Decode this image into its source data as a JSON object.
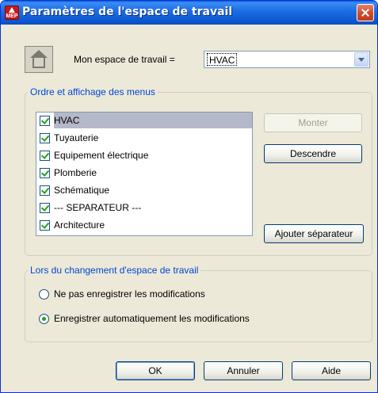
{
  "window": {
    "title": "Paramètres de l'espace de travail"
  },
  "workspace": {
    "label": "Mon espace de travail =",
    "selected_value": "HVAC"
  },
  "menu_order": {
    "group_title": "Ordre et affichage des menus",
    "items": [
      {
        "label": "HVAC",
        "checked": true,
        "selected": true
      },
      {
        "label": "Tuyauterie",
        "checked": true,
        "selected": false
      },
      {
        "label": "Equipement électrique",
        "checked": true,
        "selected": false
      },
      {
        "label": "Plomberie",
        "checked": true,
        "selected": false
      },
      {
        "label": "Schématique",
        "checked": true,
        "selected": false
      },
      {
        "label": "--- SEPARATEUR ---",
        "checked": true,
        "selected": false
      },
      {
        "label": "Architecture",
        "checked": true,
        "selected": false
      }
    ],
    "buttons": {
      "move_up": "Monter",
      "move_down": "Descendre",
      "add_separator": "Ajouter séparateur"
    }
  },
  "on_change": {
    "group_title": "Lors du changement d'espace de travail",
    "options": [
      {
        "label": "Ne pas enregistrer les modifications",
        "selected": false
      },
      {
        "label": "Enregistrer automatiquement les modifications",
        "selected": true
      }
    ]
  },
  "footer": {
    "ok": "OK",
    "cancel": "Annuler",
    "help": "Aide"
  },
  "colors": {
    "title_bar": "#1e6fe6",
    "group_title_text": "#0046d5",
    "checkmark": "#21a121",
    "selection": "#b4b8c8"
  },
  "icons": {
    "app": "autocad-mep-icon",
    "close": "close-icon",
    "workspace": "house-icon",
    "dropdown": "chevron-down-icon"
  }
}
